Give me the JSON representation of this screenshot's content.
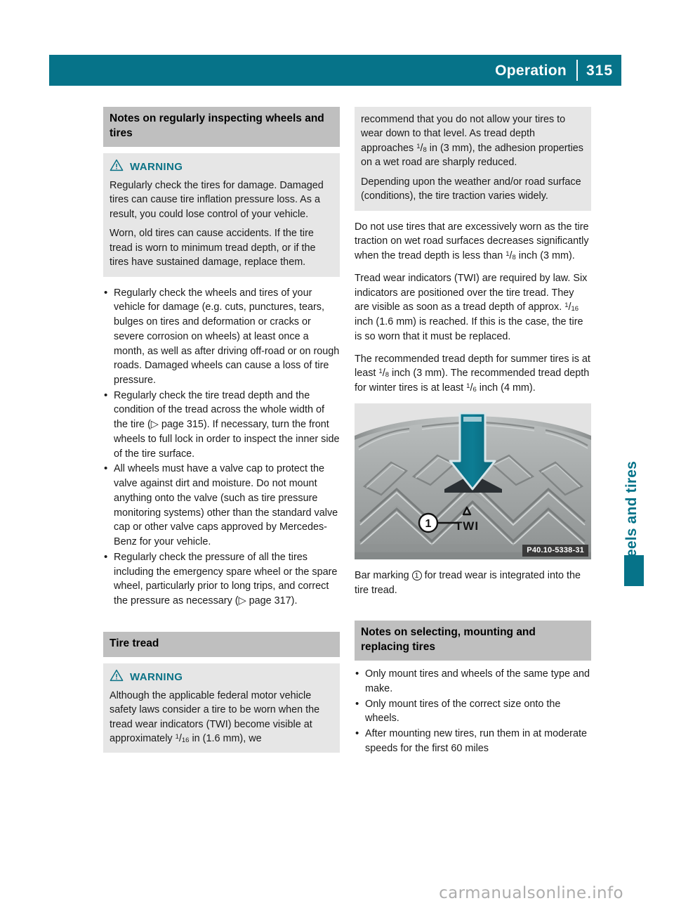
{
  "header": {
    "title": "Operation",
    "page_number": "315",
    "bar_color": "#067389"
  },
  "accent_color": "#067389",
  "left_column": {
    "section_heading": "Notes on regularly inspecting wheels and tires",
    "warning": {
      "label": "WARNING",
      "icon": "warning-triangle-icon",
      "paragraphs": [
        "Regularly check the tires for damage. Damaged tires can cause tire inflation pressure loss. As a result, you could lose control of your vehicle.",
        "Worn, old tires can cause accidents. If the tire tread is worn to minimum tread depth, or if the tires have sustained damage, replace them."
      ]
    },
    "bullets": [
      "Regularly check the wheels and tires of your vehicle for damage (e.g. cuts, punctures, tears, bulges on tires and deformation or cracks or severe corrosion on wheels) at least once a month, as well as after driving off-road or on rough roads. Damaged wheels can cause a loss of tire pressure.",
      "Regularly check the tire tread depth and the condition of the tread across the whole width of the tire (▷ page 315). If necessary, turn the front wheels to full lock in order to inspect the inner side of the tire surface.",
      "All wheels must have a valve cap to protect the valve against dirt and moisture. Do not mount anything onto the valve (such as tire pressure monitoring systems) other than the standard valve cap or other valve caps approved by Mercedes-Benz for your vehicle.",
      "Regularly check the pressure of all the tires including the emergency spare wheel or the spare wheel, particularly prior to long trips, and correct the pressure as necessary (▷ page 317)."
    ],
    "section_heading_2": "Tire tread",
    "warning_2": {
      "label": "WARNING",
      "icon": "warning-triangle-icon",
      "text_before_fraction": "Although the applicable federal motor vehicle safety laws consider a tire to be worn when the tread wear indicators (TWI) become visible at approximately ",
      "fraction_numerator": "1",
      "fraction_denominator": "16",
      "text_after_fraction": " in (1.6 mm), we"
    }
  },
  "right_column": {
    "warning_continued": {
      "part_a_before": "recommend that you do not allow your tires to wear down to that level. As tread depth approaches ",
      "frac_num": "1",
      "frac_den": "8",
      "part_a_after": " in (3 mm), the adhesion properties on a wet road are sharply reduced.",
      "part_b": "Depending upon the weather and/or road surface (conditions), the tire traction varies widely."
    },
    "paragraph_1": {
      "before": "Do not use tires that are excessively worn as the tire traction on wet road surfaces decreases significantly when the tread depth is less than ",
      "frac_num": "1",
      "frac_den": "8",
      "after": " inch (3 mm)."
    },
    "paragraph_2": {
      "before": "Tread wear indicators (TWI) are required by law. Six indicators are positioned over the tire tread. They are visible as soon as a tread depth of approx. ",
      "frac_num": "1",
      "frac_den": "16",
      "after": " inch (1.6 mm) is reached. If this is the case, the tire is so worn that it must be replaced."
    },
    "paragraph_3": {
      "before": "The recommended tread depth for summer tires is at least ",
      "frac_num": "1",
      "frac_den": "8",
      "mid": " inch (3 mm). The recommended tread depth for winter tires is at least ",
      "frac_num_2": "1",
      "frac_den_2": "6",
      "after": " inch (4 mm)."
    },
    "figure": {
      "alt_name": "tire-tread-twi-diagram",
      "caption": "P40.10-5338-31",
      "callout_number": "1",
      "marking_label": "TWI",
      "arrow_color": "#0b7286"
    },
    "figure_note": {
      "before": "Bar marking ",
      "callout": "1",
      "after": " for tread wear is integrated into the tire tread."
    },
    "section_heading": "Notes on selecting, mounting and replacing tires",
    "bullets": [
      "Only mount tires and wheels of the same type and make.",
      "Only mount tires of the correct size onto the wheels.",
      "After mounting new tires, run them in at moderate speeds for the first 60 miles"
    ]
  },
  "edge_tab": {
    "label": "Wheels and tires"
  },
  "watermark": "carmanualsonline.info"
}
